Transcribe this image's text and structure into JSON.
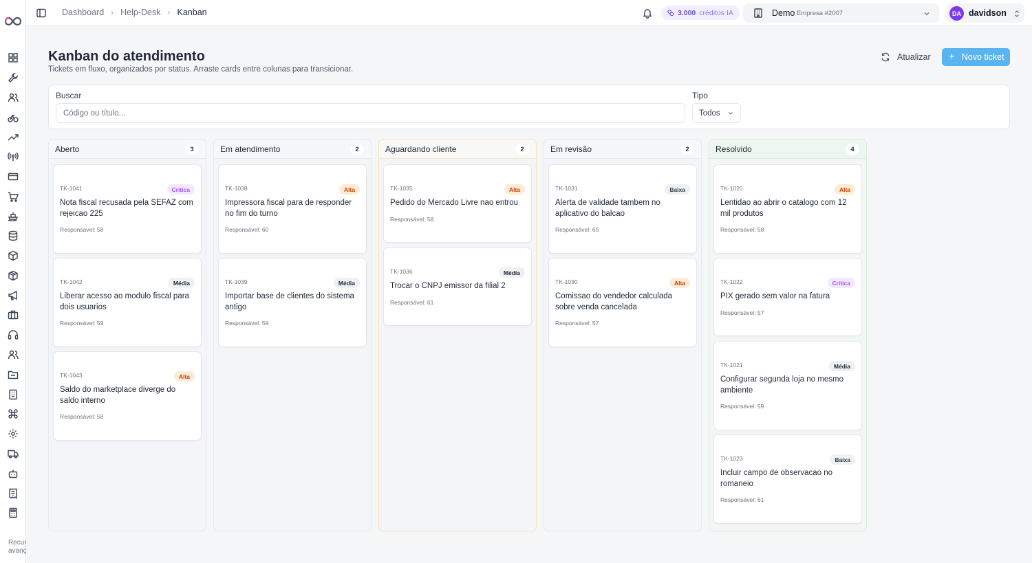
{
  "nav": {
    "icons": [
      "grid-icon",
      "wrench-icon",
      "users-icon",
      "bike-icon",
      "trending-up-icon",
      "radio-icon",
      "credit-card-icon",
      "cart-icon",
      "ship-icon",
      "database-icon",
      "box-icon",
      "package-icon",
      "megaphone-icon",
      "briefcase-icon",
      "headset-icon",
      "contacts-icon",
      "folder-icon",
      "building-icon",
      "command-icon",
      "settings-icon",
      "truck-icon",
      "bot-icon",
      "receipt-icon",
      "calculator-icon"
    ],
    "footer": "Recursos avançados"
  },
  "topbar": {
    "breadcrumb": [
      "Dashboard",
      "Help-Desk",
      "Kanban"
    ],
    "credits_amount": "3.000",
    "credits_label": "créditos IA",
    "company_name": "Demo",
    "company_sub": "Empresa #2007",
    "user_initials": "DA",
    "user_name": "davidson"
  },
  "header": {
    "title": "Kanban do atendimento",
    "subtitle": "Tickets em fluxo, organizados por status. Arraste cards entre colunas para transicionar.",
    "refresh_label": "Atualizar",
    "new_label": "Novo ticket"
  },
  "filters": {
    "search_label": "Buscar",
    "search_placeholder": "Código ou título...",
    "type_label": "Tipo",
    "type_value": "Todos"
  },
  "columns": [
    {
      "title": "Aberto",
      "count": "3",
      "cards": [
        {
          "code": "TK-1041",
          "badge": "Crítica",
          "title": "Nota fiscal recusada pela SEFAZ com rejeicao 225",
          "resp": "Responsável: 58"
        },
        {
          "code": "TK-1042",
          "badge": "Média",
          "title": "Liberar acesso ao modulo fiscal para dois usuarios",
          "resp": "Responsável: 59"
        },
        {
          "code": "TK-1043",
          "badge": "Alta",
          "title": "Saldo do marketplace diverge do saldo interno",
          "resp": "Responsável: 58"
        }
      ]
    },
    {
      "title": "Em atendimento",
      "count": "2",
      "cards": [
        {
          "code": "TK-1038",
          "badge": "Alta",
          "title": "Impressora fiscal para de responder no fim do turno",
          "resp": "Responsável: 60"
        },
        {
          "code": "TK-1039",
          "badge": "Média",
          "title": "Importar base de clientes do sistema antigo",
          "resp": "Responsável: 59"
        }
      ]
    },
    {
      "title": "Aguardando cliente",
      "count": "2",
      "cards": [
        {
          "code": "TK-1035",
          "badge": "Alta",
          "title": "Pedido do Mercado Livre nao entrou",
          "resp": "Responsável: 58"
        },
        {
          "code": "TK-1036",
          "badge": "Média",
          "title": "Trocar o CNPJ emissor da filial 2",
          "resp": "Responsável: 61"
        }
      ]
    },
    {
      "title": "Em revisão",
      "count": "2",
      "cards": [
        {
          "code": "TK-1031",
          "badge": "Baixa",
          "title": "Alerta de validade tambem no aplicativo do balcao",
          "resp": "Responsável: 65"
        },
        {
          "code": "TK-1030",
          "badge": "Alta",
          "title": "Comissao do vendedor calculada sobre venda cancelada",
          "resp": "Responsável: 57"
        }
      ]
    },
    {
      "title": "Resolvido",
      "count": "4",
      "cards": [
        {
          "code": "TK-1020",
          "badge": "Alta",
          "title": "Lentidao ao abrir o catalogo com 12 mil produtos",
          "resp": "Responsável: 58"
        },
        {
          "code": "TK-1022",
          "badge": "Crítica",
          "title": "PIX gerado sem valor na fatura",
          "resp": "Responsável: 57"
        },
        {
          "code": "TK-1021",
          "badge": "Média",
          "title": "Configurar segunda loja no mesmo ambiente",
          "resp": "Responsável: 59"
        },
        {
          "code": "TK-1023",
          "badge": "Baixa",
          "title": "Incluir campo de observacao no romaneio",
          "resp": "Responsável: 61"
        }
      ]
    }
  ],
  "colors": {
    "accent": "#5ab4ef",
    "avatar": "#7c3aed",
    "credits": "#6d4fd8",
    "critica": "#a855f7",
    "alta": "#c2410c"
  }
}
